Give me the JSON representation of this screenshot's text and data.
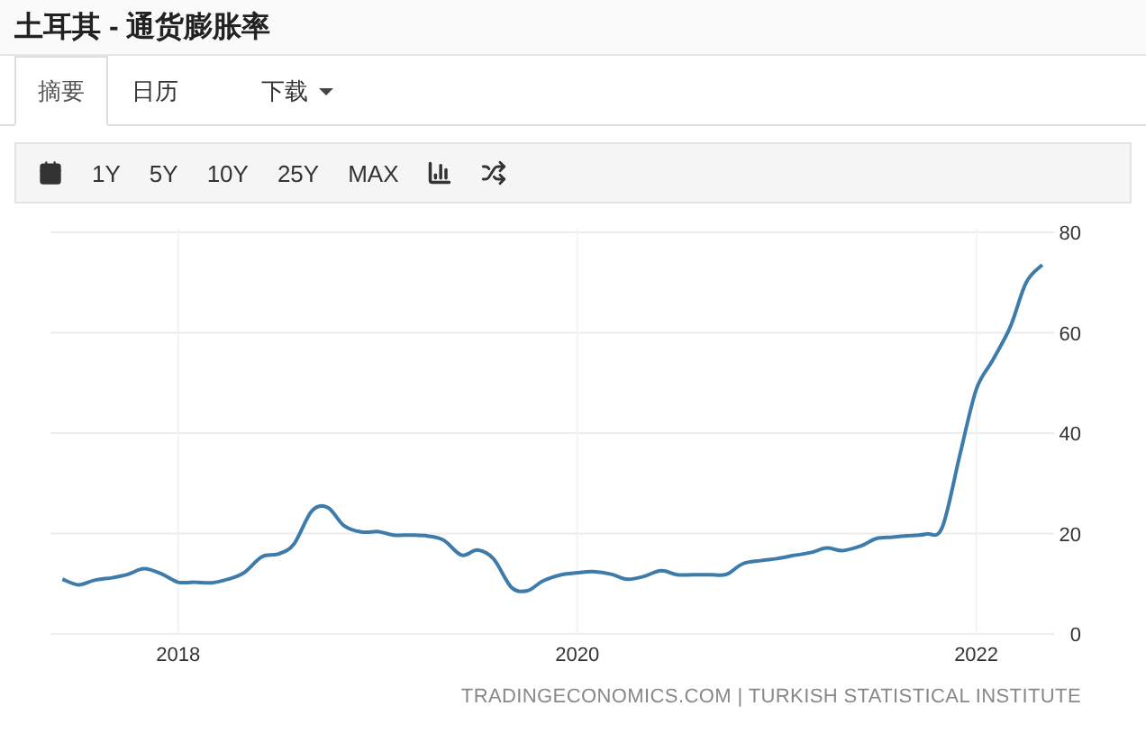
{
  "title": "土耳其 - 通货膨胀率",
  "tabs": [
    {
      "label": "摘要",
      "selected": true
    },
    {
      "label": "日历",
      "selected": false
    },
    {
      "label": "下载",
      "selected": false,
      "dropdown": true
    }
  ],
  "range_buttons": [
    "1Y",
    "5Y",
    "10Y",
    "25Y",
    "MAX"
  ],
  "chart_data": {
    "type": "line",
    "xlim": [
      2017.36,
      2022.39
    ],
    "ylim": [
      0,
      80
    ],
    "grid": true,
    "xticks": [
      {
        "value": 2018,
        "label": "2018"
      },
      {
        "value": 2020,
        "label": "2020"
      },
      {
        "value": 2022,
        "label": "2022"
      }
    ],
    "yticks": [
      0,
      20,
      40,
      60,
      80
    ],
    "x": [
      2017.42,
      2017.5,
      2017.58,
      2017.67,
      2017.75,
      2017.83,
      2017.92,
      2018,
      2018.08,
      2018.17,
      2018.25,
      2018.33,
      2018.42,
      2018.5,
      2018.58,
      2018.67,
      2018.75,
      2018.83,
      2018.92,
      2019,
      2019.08,
      2019.17,
      2019.25,
      2019.33,
      2019.42,
      2019.5,
      2019.58,
      2019.67,
      2019.75,
      2019.83,
      2019.92,
      2020,
      2020.08,
      2020.17,
      2020.25,
      2020.33,
      2020.42,
      2020.5,
      2020.58,
      2020.67,
      2020.75,
      2020.83,
      2020.92,
      2021,
      2021.08,
      2021.17,
      2021.25,
      2021.33,
      2021.42,
      2021.5,
      2021.58,
      2021.67,
      2021.75,
      2021.83,
      2021.92,
      2022,
      2022.08,
      2022.17,
      2022.25,
      2022.33
    ],
    "series": [
      {
        "color": "#3d7bab",
        "values": [
          10.9,
          9.8,
          10.7,
          11.2,
          11.9,
          13.0,
          11.9,
          10.3,
          10.3,
          10.2,
          10.9,
          12.2,
          15.4,
          15.9,
          17.9,
          24.5,
          25.2,
          21.6,
          20.3,
          20.4,
          19.7,
          19.7,
          19.5,
          18.7,
          15.7,
          16.7,
          15.0,
          9.3,
          8.6,
          10.6,
          11.8,
          12.2,
          12.4,
          11.9,
          10.9,
          11.4,
          12.6,
          11.8,
          11.8,
          11.8,
          11.9,
          14.0,
          14.6,
          15.0,
          15.6,
          16.2,
          17.1,
          16.6,
          17.5,
          19.0,
          19.3,
          19.6,
          19.9,
          21.3,
          36.1,
          48.7,
          54.4,
          61.1,
          70.0,
          73.5
        ]
      }
    ]
  },
  "source": "TRADINGECONOMICS.COM | TURKISH STATISTICAL INSTITUTE"
}
